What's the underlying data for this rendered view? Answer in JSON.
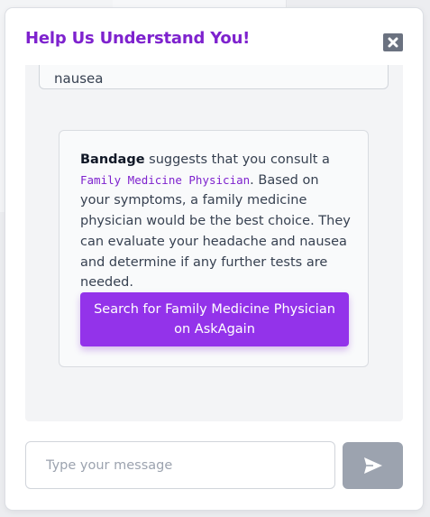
{
  "modal": {
    "title": "Help Us Understand You!",
    "close_icon": "close-icon"
  },
  "chat": {
    "user_message": "nausea",
    "bot_reply": {
      "bot_name": "Bandage",
      "text_before": " suggests that you consult a ",
      "specialist": "Family Medicine Physician",
      "text_after": ". Based on your symptoms, a family medicine physician would be the best choice. They can evaluate your headache and nausea and determine if any further tests are needed.",
      "search_button_label": "Search for Family Medicine Physician on AskAgain"
    }
  },
  "composer": {
    "placeholder": "Type your message",
    "value": "",
    "send_icon": "send-icon"
  },
  "colors": {
    "accent": "#7e22ce",
    "button": "#9333ea",
    "send_disabled": "#9ca3af"
  }
}
